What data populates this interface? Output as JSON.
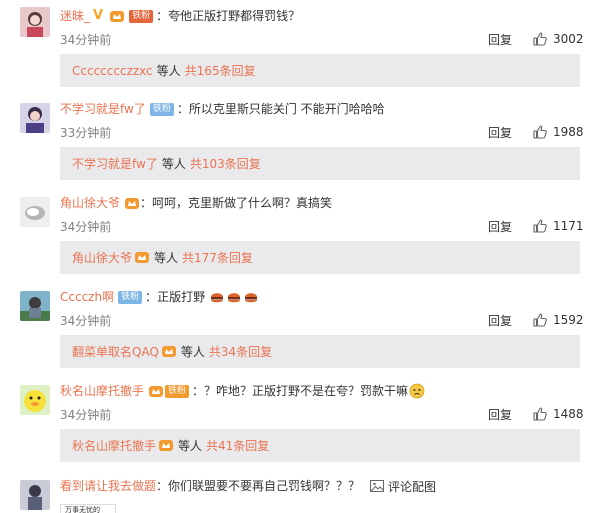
{
  "comments": [
    {
      "username": "迷昧_",
      "badge_v": "V",
      "fan_badge": "铁粉",
      "text": "：夸他正版打野都得罚钱？",
      "time": "34分钟前",
      "reply_label": "回复",
      "likes": "3002",
      "replies": {
        "user": "Cccccccczzxc",
        "more": "等人",
        "total": "共165条回复"
      }
    },
    {
      "username": "不学习就是fw了",
      "fan_badge": "铁粉",
      "text": "：所以克里斯只能关门 不能开门哈哈哈",
      "time": "33分钟前",
      "reply_label": "回复",
      "likes": "1988",
      "replies": {
        "user": "不学习就是fw了",
        "more": "等人",
        "total": "共103条回复"
      }
    },
    {
      "username": "角山徐大爷",
      "text": "：呵呵，克里斯做了什么啊？真搞笑",
      "time": "34分钟前",
      "reply_label": "回复",
      "likes": "1171",
      "replies": {
        "user": "角山徐大爷",
        "more": "等人",
        "total": "共177条回复"
      }
    },
    {
      "username": "Cccczh啊",
      "fan_badge": "铁粉",
      "text": "：正版打野",
      "time": "34分钟前",
      "reply_label": "回复",
      "likes": "1592",
      "replies": {
        "user": "翻菜单取名QAQ",
        "more": "等人",
        "total": "共34条回复"
      }
    },
    {
      "username": "秋名山摩托撤手",
      "fan_badge": "铁粉",
      "text": "：？咋地？正版打野不是在夸？罚款干嘛",
      "time": "34分钟前",
      "reply_label": "回复",
      "likes": "1488",
      "replies": {
        "user": "秋名山摩托撤手",
        "more": "等人",
        "total": "共41条回复"
      }
    },
    {
      "username": "看到请让我去做题",
      "text": "：你们联盟要不要再自己罚钱啊？？？",
      "pic_link": "评论配图"
    }
  ],
  "bottom_strip_text": "万事无忧的",
  "colors": {
    "username": "#eb7350",
    "subbox_bg": "#eaeaec",
    "time": "#808080"
  }
}
